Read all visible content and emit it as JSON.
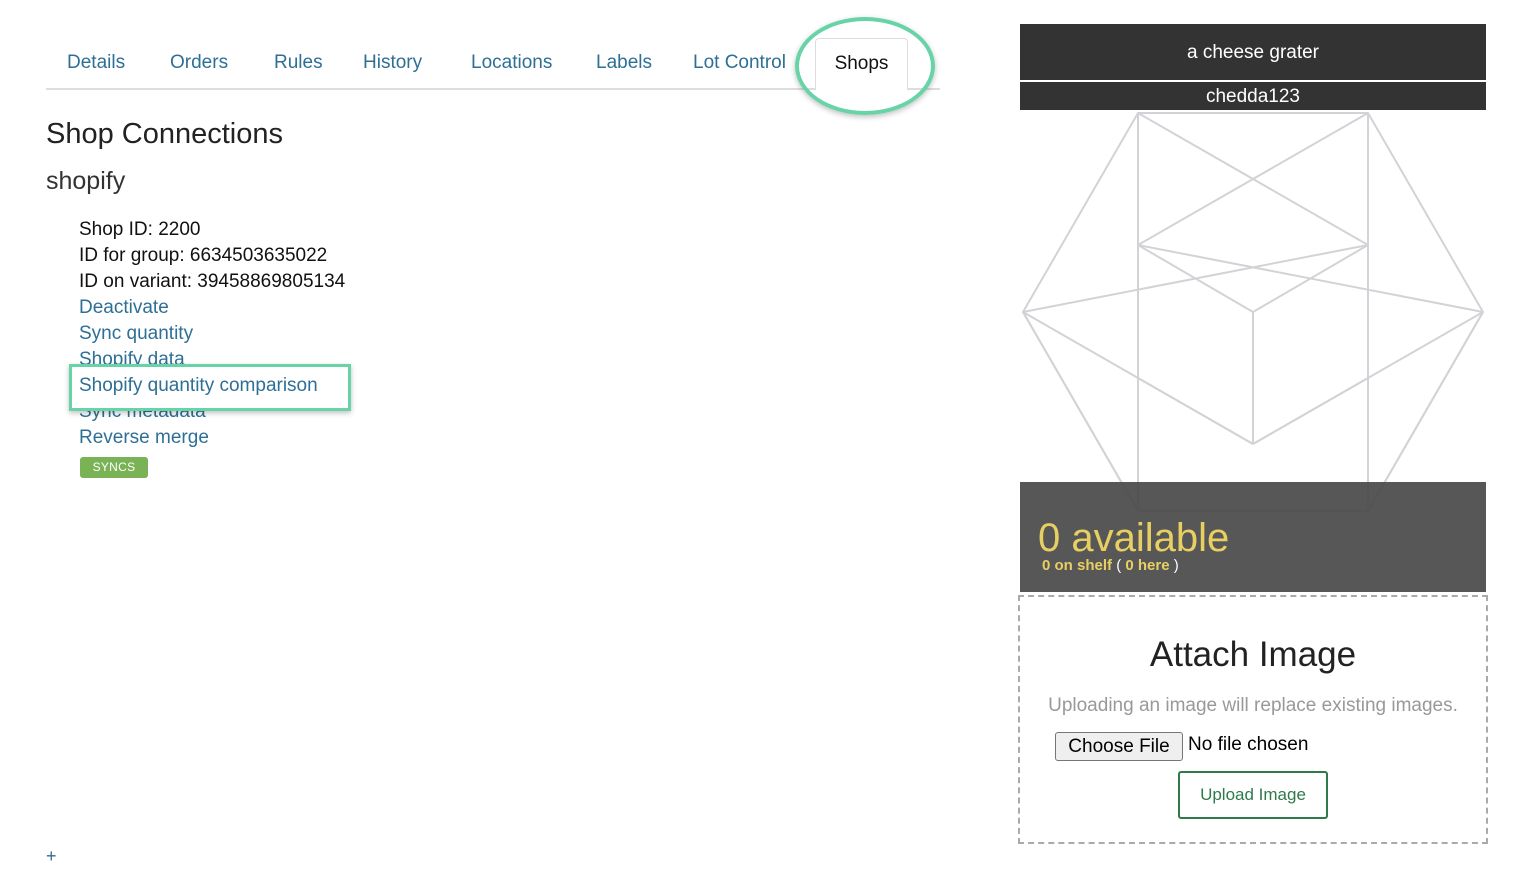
{
  "tabs": [
    {
      "label": "Details",
      "active": false
    },
    {
      "label": "Orders",
      "active": false
    },
    {
      "label": "Rules",
      "active": false
    },
    {
      "label": "History",
      "active": false
    },
    {
      "label": "Locations",
      "active": false
    },
    {
      "label": "Labels",
      "active": false
    },
    {
      "label": "Lot Control",
      "active": false
    },
    {
      "label": "Shops",
      "active": true
    }
  ],
  "main": {
    "heading": "Shop Connections",
    "shop_name": "shopify",
    "shop_id": "Shop ID: 2200",
    "group_id": "ID for group: 6634503635022",
    "variant_id": "ID on variant: 39458869805134",
    "links": {
      "deactivate": "Deactivate",
      "sync_quantity": "Sync quantity",
      "shopify_data": "Shopify data",
      "quantity_comparison": "Shopify quantity comparison",
      "sync_metadata": "Sync metadata",
      "reverse_merge": "Reverse merge"
    },
    "badge": "SYNCS",
    "add_label": "+"
  },
  "product": {
    "title": "a cheese grater",
    "sku": "chedda123",
    "available": "0 available",
    "on_shelf": "0 on shelf",
    "open_paren": "(",
    "here": "0 here",
    "close_paren": ")"
  },
  "attach": {
    "title": "Attach Image",
    "note": "Uploading an image will replace existing images.",
    "choose_file": "Choose File",
    "file_status": "No file chosen",
    "upload_button": "Upload Image"
  },
  "colors": {
    "link": "#2e6f96",
    "highlight": "#67d3a6",
    "badge": "#7ab356",
    "available": "#e8cf62",
    "upload_button": "#2f7a4b"
  }
}
